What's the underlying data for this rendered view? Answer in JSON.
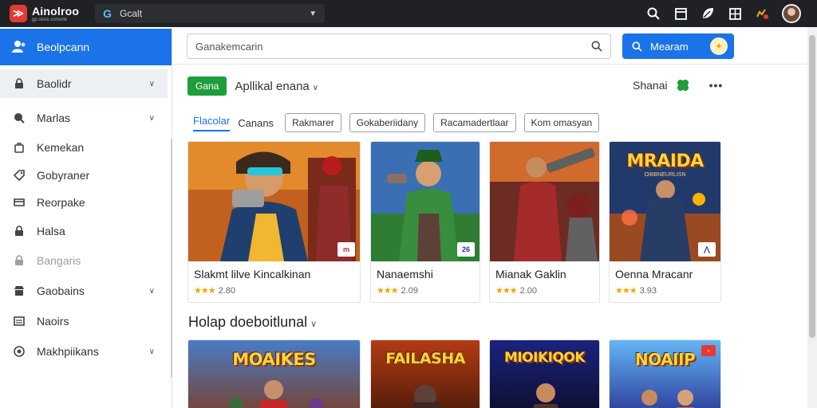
{
  "app": {
    "title": "Ainolroo",
    "subtitle": "gp.store.console",
    "account_label": "Gcalt"
  },
  "topbar_icons": [
    "search-icon",
    "window-icon",
    "leaf-icon",
    "grid-icon",
    "notification-icon"
  ],
  "sidebar": {
    "header": "Beolpcann",
    "items": [
      {
        "label": "Baolidr",
        "icon": "lock-icon",
        "chevron": true,
        "active": true
      },
      {
        "label": "Marlas",
        "icon": "pin-icon",
        "chevron": true
      },
      {
        "label": "Kemekan",
        "icon": "bag-icon",
        "chevron": false
      },
      {
        "label": "Gobyraner",
        "icon": "tag-icon",
        "chevron": false
      },
      {
        "label": "Reorpake",
        "icon": "card-icon",
        "chevron": false
      },
      {
        "label": "Halsa",
        "icon": "lock-icon",
        "chevron": false
      },
      {
        "label": "Bangaris",
        "icon": "lock-icon",
        "chevron": false,
        "dim": true
      },
      {
        "label": "Gaobains",
        "icon": "store-icon",
        "chevron": true
      },
      {
        "label": "Naoirs",
        "icon": "list-icon",
        "chevron": false
      },
      {
        "label": "Makhpiikans",
        "icon": "target-icon",
        "chevron": true
      }
    ]
  },
  "search": {
    "placeholder": "Ganakemcarin",
    "button_label": "Mearam"
  },
  "category": {
    "pill": "Gana",
    "title": "Apllikal enana",
    "right_label": "Shanai"
  },
  "tabs": {
    "items": [
      "Flacolar",
      "Canans"
    ],
    "chips": [
      "Rakmarer",
      "Gokaberiidany",
      "Racamadertlaar",
      "Kom omasyan"
    ]
  },
  "games": [
    {
      "name": "Slakmt lilve Kincalkinan",
      "rating": "2.80",
      "stars": "★★★",
      "badge": "m",
      "badge_color": "#c62828"
    },
    {
      "name": "Nanaemshi",
      "rating": "2.09",
      "stars": "★★★",
      "badge": "26",
      "badge_color": "#283593"
    },
    {
      "name": "Mianak Gaklin",
      "rating": "2.00",
      "stars": "★★★",
      "badge": "",
      "badge_color": "#000000"
    },
    {
      "name": "Oenna Mracanr",
      "rating": "3.93",
      "stars": "★★★",
      "badge": "⋀",
      "badge_color": "#283593"
    }
  ],
  "posters": [
    {
      "title": "MRAIDA",
      "subtitle": "OIBBNEURLISN"
    },
    {
      "title": "MOAIKES",
      "subtitle": ""
    },
    {
      "title": "FAILASHA",
      "subtitle": ""
    },
    {
      "title": "MIOIKIQOK",
      "subtitle": ""
    },
    {
      "title": "NOAIIP",
      "subtitle": ""
    }
  ],
  "section": {
    "title": "Holap doeboitlunal"
  }
}
